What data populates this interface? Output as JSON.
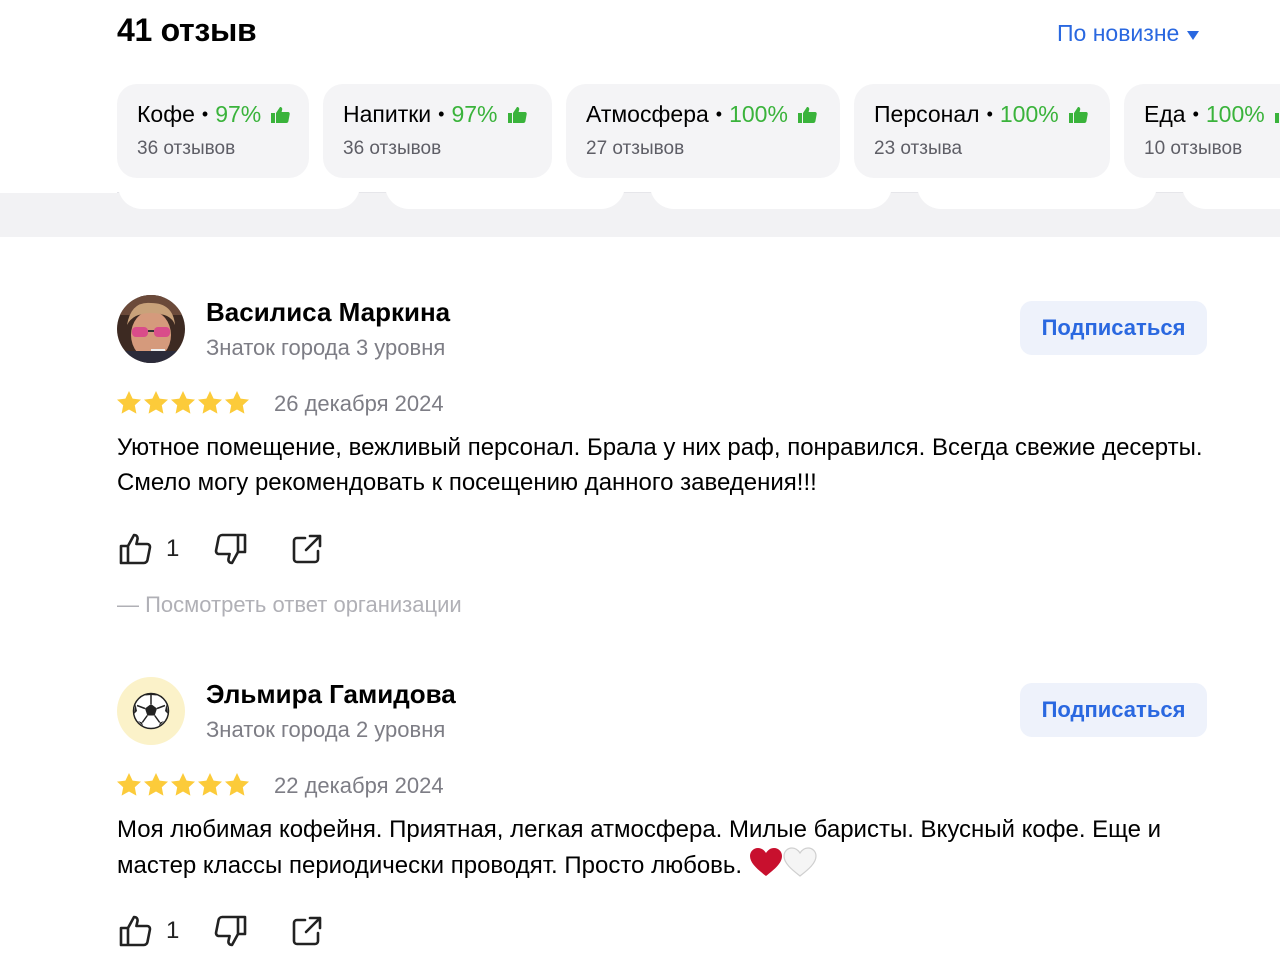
{
  "header": {
    "count_title": "41 отзыв",
    "sort_label": "По новизне"
  },
  "categories": [
    {
      "name": "Кофе",
      "percent": "97%",
      "count": "36 отзывов"
    },
    {
      "name": "Напитки",
      "percent": "97%",
      "count": "36 отзывов"
    },
    {
      "name": "Атмосфера",
      "percent": "100%",
      "count": "27 отзывов"
    },
    {
      "name": "Персонал",
      "percent": "100%",
      "count": "23 отзыва"
    },
    {
      "name": "Еда",
      "percent": "100%",
      "count": "10 отзывов"
    }
  ],
  "reviews": [
    {
      "author": "Василиса Маркина",
      "level": "Знаток города 3 уровня",
      "subscribe_label": "Подписаться",
      "rating": 5,
      "date": "26 декабря 2024",
      "text": "Уютное помещение, вежливый персонал. Брала у них раф, понравился. Всегда свежие десерты. Смело могу рекомендовать к посещению данного заведения!!!",
      "likes": "1",
      "reply_link": "— Посмотреть ответ организации"
    },
    {
      "author": "Эльмира Гамидова",
      "level": "Знаток города 2 уровня",
      "subscribe_label": "Подписаться",
      "rating": 5,
      "date": "22 декабря 2024",
      "text": "Моя любимая кофейня. Приятная, легкая атмосфера. Милые баристы. Вкусный кофе. Еще и мастер классы периодически проводят. Просто любовь.",
      "text_emoji": [
        "red-heart-icon",
        "white-heart-icon"
      ],
      "likes": "1"
    }
  ],
  "colors": {
    "accent": "#2a68e0",
    "positive": "#3ab33b",
    "star": "#fccb3a",
    "muted": "#7d7d85"
  }
}
